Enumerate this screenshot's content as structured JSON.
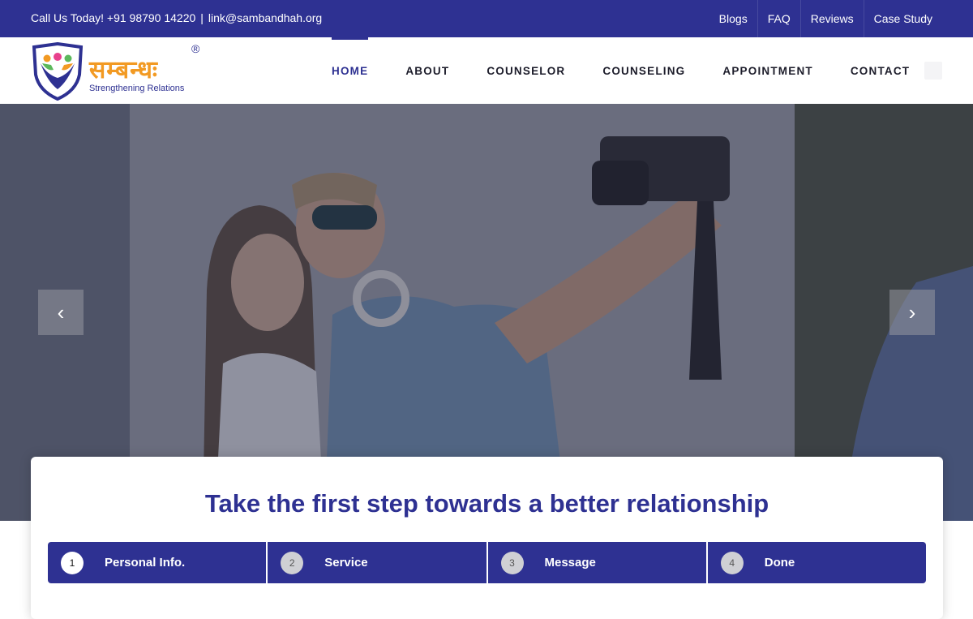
{
  "topbar": {
    "contact_text": "Call Us Today! +91 98790 14220",
    "separator": "|",
    "email": "link@sambandhah.org",
    "links": [
      "Blogs",
      "FAQ",
      "Reviews",
      "Case Study"
    ]
  },
  "logo": {
    "brand": "सम्बन्धः",
    "tagline": "Strengthening Relations",
    "registered": "®"
  },
  "nav": {
    "items": [
      "HOME",
      "ABOUT",
      "COUNSELOR",
      "COUNSELING",
      "APPOINTMENT",
      "CONTACT"
    ],
    "active": "HOME"
  },
  "slider": {
    "prev_glyph": "‹",
    "next_glyph": "›"
  },
  "form": {
    "title": "Take the first step towards a better relationship",
    "steps": [
      {
        "num": "1",
        "label": "Personal Info."
      },
      {
        "num": "2",
        "label": "Service"
      },
      {
        "num": "3",
        "label": "Message"
      },
      {
        "num": "4",
        "label": "Done"
      }
    ],
    "current_step": 1
  },
  "colors": {
    "primary": "#2e3192",
    "accent": "#f29a23"
  }
}
